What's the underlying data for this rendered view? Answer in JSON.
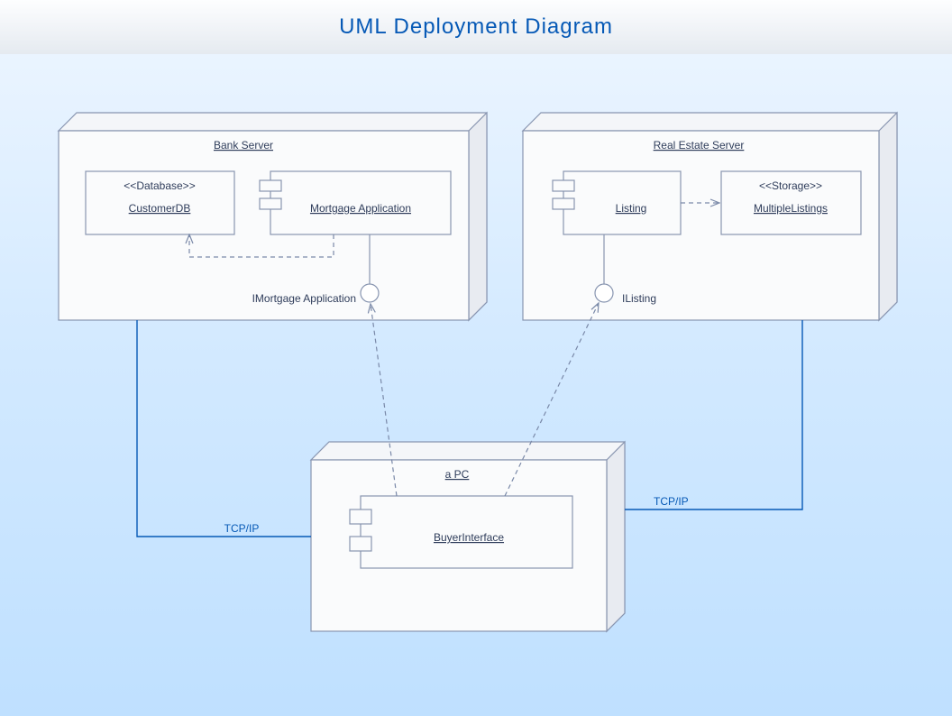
{
  "header": {
    "title": "UML Deployment Diagram"
  },
  "nodes": {
    "bankServer": {
      "label": "Bank Server"
    },
    "realEstateServer": {
      "label": "Real Estate Server"
    },
    "pc": {
      "label": "a PC"
    }
  },
  "components": {
    "customerDB": {
      "stereotype": "<<Database>>",
      "label": "CustomerDB"
    },
    "mortgageApp": {
      "label": "Mortgage Application"
    },
    "listing": {
      "label": "Listing"
    },
    "multipleListings": {
      "stereotype": "<<Storage>>",
      "label": "MultipleListings"
    },
    "buyerInterface": {
      "label": "BuyerInterface"
    }
  },
  "interfaces": {
    "iMortgageApp": {
      "label": "IMortgage Application"
    },
    "iListing": {
      "label": "IListing"
    }
  },
  "connections": {
    "tcp1": {
      "label": "TCP/IP"
    },
    "tcp2": {
      "label": "TCP/IP"
    }
  }
}
